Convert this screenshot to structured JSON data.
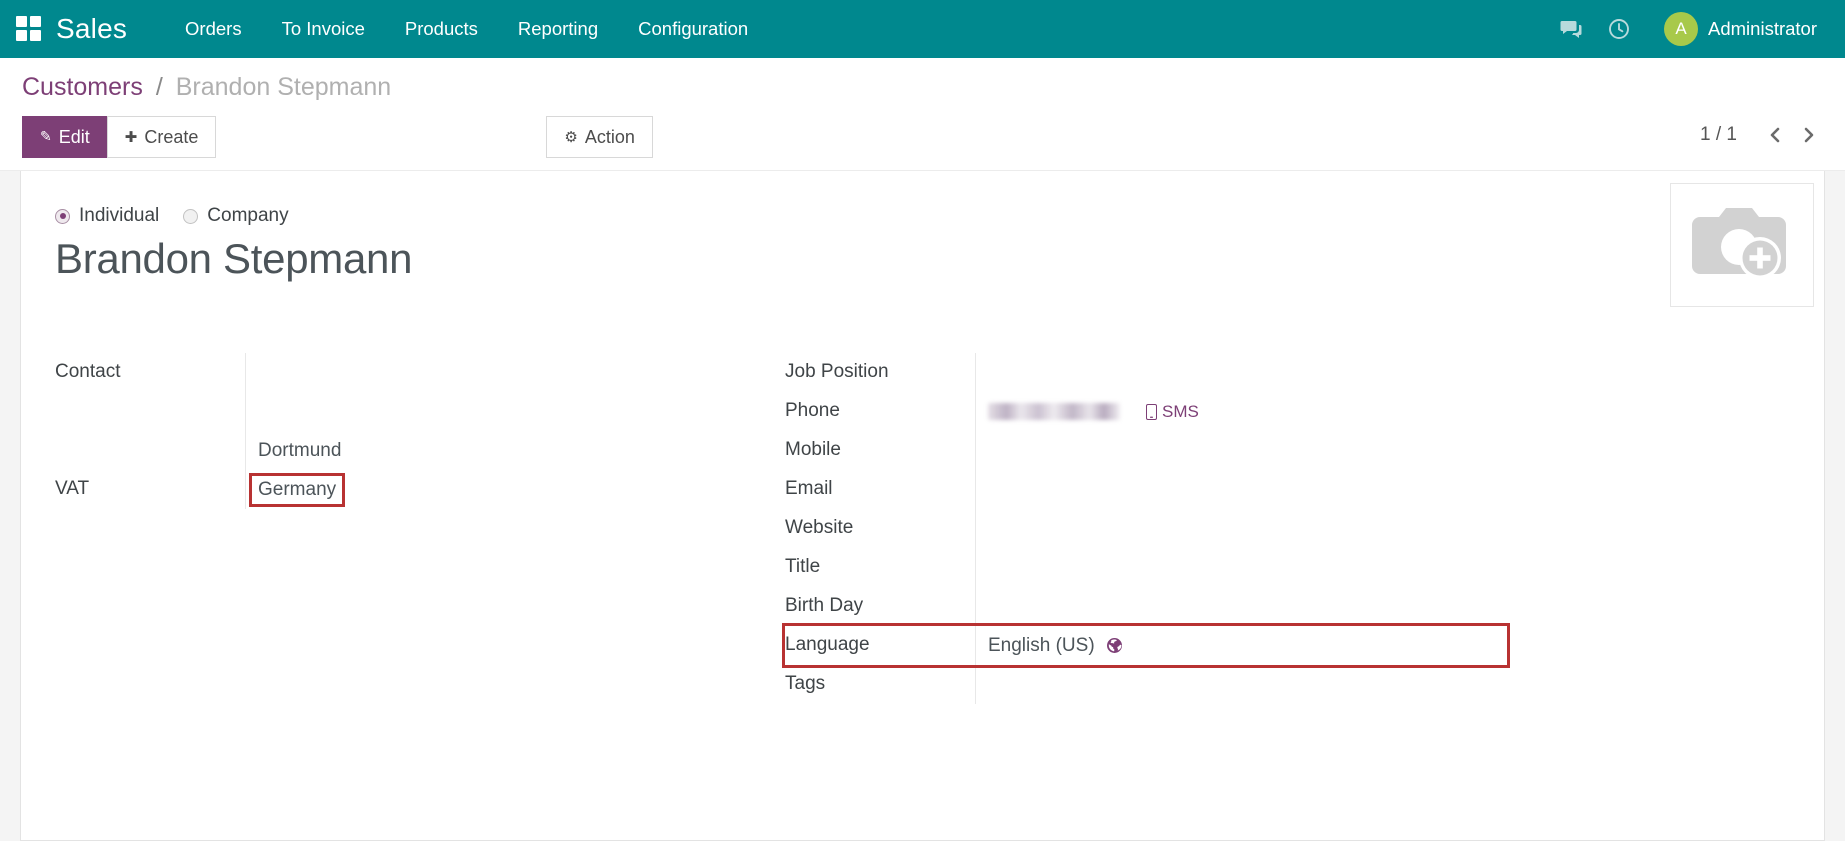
{
  "navbar": {
    "apps_icon": "apps-grid-icon",
    "brand": "Sales",
    "menu": [
      {
        "label": "Orders"
      },
      {
        "label": "To Invoice"
      },
      {
        "label": "Products"
      },
      {
        "label": "Reporting"
      },
      {
        "label": "Configuration"
      }
    ],
    "messages_icon": "messages-icon",
    "activities_icon": "clock-activities-icon",
    "avatar_initial": "A",
    "user_name": "Administrator",
    "bg_color": "#00888e",
    "avatar_color": "#a8c94a"
  },
  "control_panel": {
    "breadcrumb": {
      "parent": "Customers",
      "separator": "/",
      "current": "Brandon Stepmann"
    },
    "edit_label": "Edit",
    "create_label": "Create",
    "action_label": "Action",
    "pager": {
      "value": "1 / 1",
      "prev_icon": "chevron-left-icon",
      "next_icon": "chevron-right-icon"
    },
    "primary_color": "#7d3f76"
  },
  "form": {
    "company_type": {
      "individual_label": "Individual",
      "company_label": "Company",
      "selected": "Individual"
    },
    "record_name": "Brandon Stepmann",
    "image_placeholder_icon": "camera-add-icon",
    "left_group": {
      "contact_label": "Contact",
      "vat_label": "VAT",
      "vat_value": "",
      "address": {
        "street": "",
        "street2": "",
        "city": "Dortmund",
        "country": "Germany",
        "country_highlighted": true
      }
    },
    "right_group": [
      {
        "label": "Job Position",
        "value": ""
      },
      {
        "label": "Phone",
        "value": "",
        "redacted": true,
        "sms_label": "SMS",
        "sms_icon": "mobile-icon"
      },
      {
        "label": "Mobile",
        "value": ""
      },
      {
        "label": "Email",
        "value": ""
      },
      {
        "label": "Website",
        "value": ""
      },
      {
        "label": "Title",
        "value": ""
      },
      {
        "label": "Birth Day",
        "value": ""
      },
      {
        "label": "Language",
        "value": "English (US)",
        "icon": "globe-icon",
        "highlighted": true
      },
      {
        "label": "Tags",
        "value": ""
      }
    ],
    "highlight_color": "#b83232"
  }
}
